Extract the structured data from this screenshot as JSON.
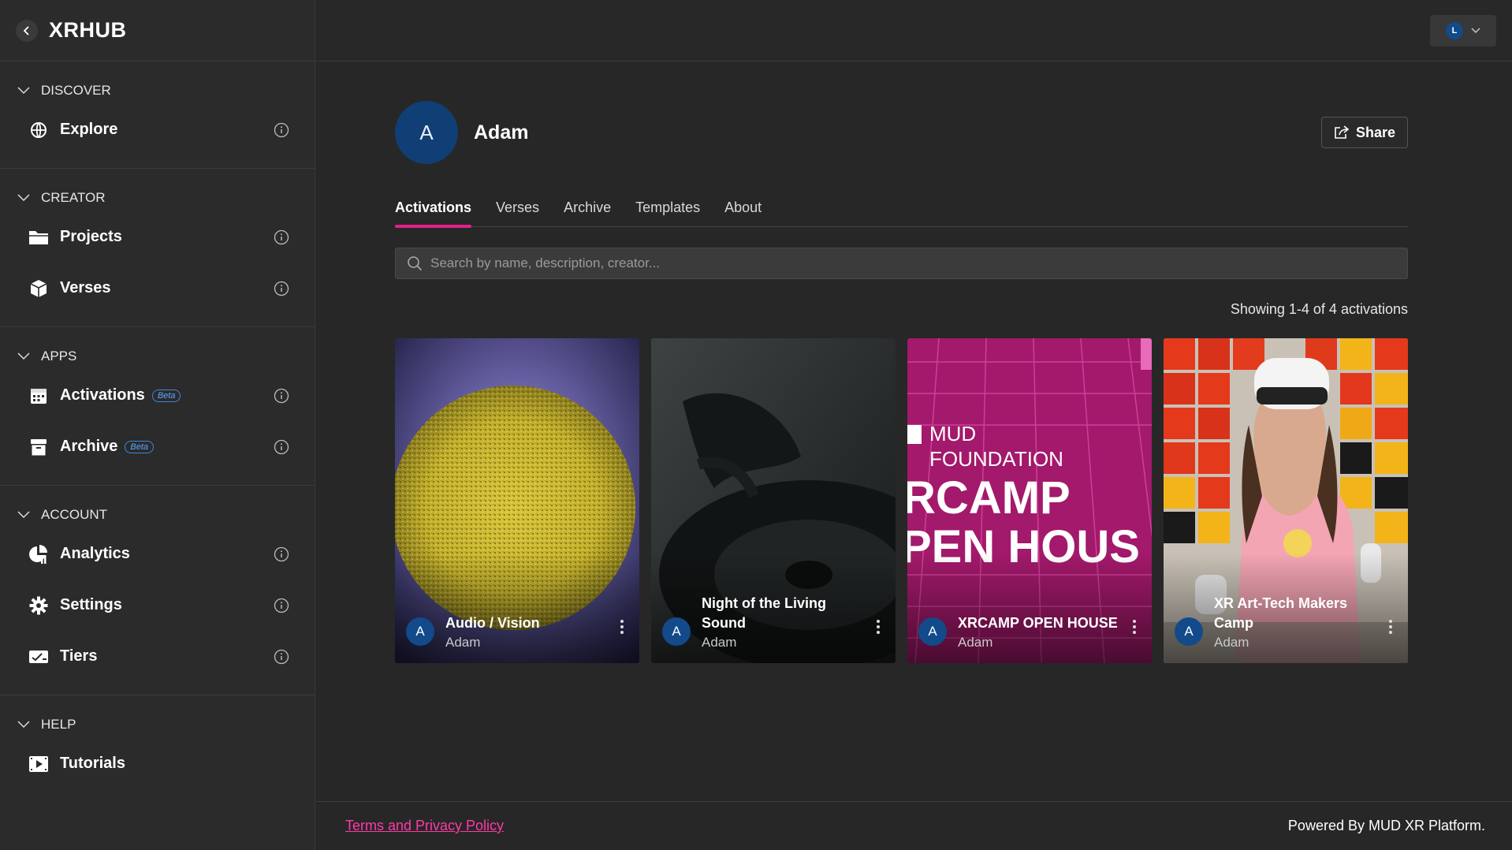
{
  "brand": {
    "title": "XRHUB"
  },
  "sidebar": {
    "sections": [
      {
        "title": "DISCOVER",
        "items": [
          {
            "label": "Explore",
            "icon": "globe-icon"
          }
        ]
      },
      {
        "title": "CREATOR",
        "items": [
          {
            "label": "Projects",
            "icon": "folder-icon"
          },
          {
            "label": "Verses",
            "icon": "cube-icon"
          }
        ]
      },
      {
        "title": "APPS",
        "items": [
          {
            "label": "Activations",
            "icon": "calendar-icon",
            "badge": "Beta"
          },
          {
            "label": "Archive",
            "icon": "archive-box-icon",
            "badge": "Beta"
          }
        ]
      },
      {
        "title": "ACCOUNT",
        "items": [
          {
            "label": "Analytics",
            "icon": "analytics-icon"
          },
          {
            "label": "Settings",
            "icon": "gear-icon"
          },
          {
            "label": "Tiers",
            "icon": "ticket-icon"
          }
        ]
      },
      {
        "title": "HELP",
        "items": [
          {
            "label": "Tutorials",
            "icon": "video-icon"
          }
        ]
      }
    ]
  },
  "topbar": {
    "user_initial": "L"
  },
  "profile": {
    "initial": "A",
    "name": "Adam",
    "share_label": "Share"
  },
  "tabs": [
    "Activations",
    "Verses",
    "Archive",
    "Templates",
    "About"
  ],
  "active_tab": "Activations",
  "search": {
    "placeholder": "Search by name, description, creator..."
  },
  "results": {
    "count_text": "Showing 1-4 of 4 activations"
  },
  "cards": [
    {
      "title": "Audio / Vision",
      "author": "Adam",
      "initial": "A"
    },
    {
      "title": "Night of the Living Sound",
      "author": "Adam",
      "initial": "A"
    },
    {
      "title": "XRCAMP OPEN HOUSE",
      "author": "Adam",
      "initial": "A"
    },
    {
      "title": "XR Art-Tech Makers Camp",
      "author": "Adam",
      "initial": "A"
    }
  ],
  "card_art": {
    "poster_line1": "MUD",
    "poster_line2": "FOUNDATION",
    "poster_line3": "RCAMP",
    "poster_line4": "PEN HOUS"
  },
  "footer": {
    "terms_label": "Terms and Privacy Policy",
    "powered_label": "Powered By MUD XR Platform."
  },
  "colors": {
    "accent": "#e0218a",
    "link": "#ff3aa7",
    "avatar": "#124a8a",
    "badge": "#3f86d8"
  }
}
